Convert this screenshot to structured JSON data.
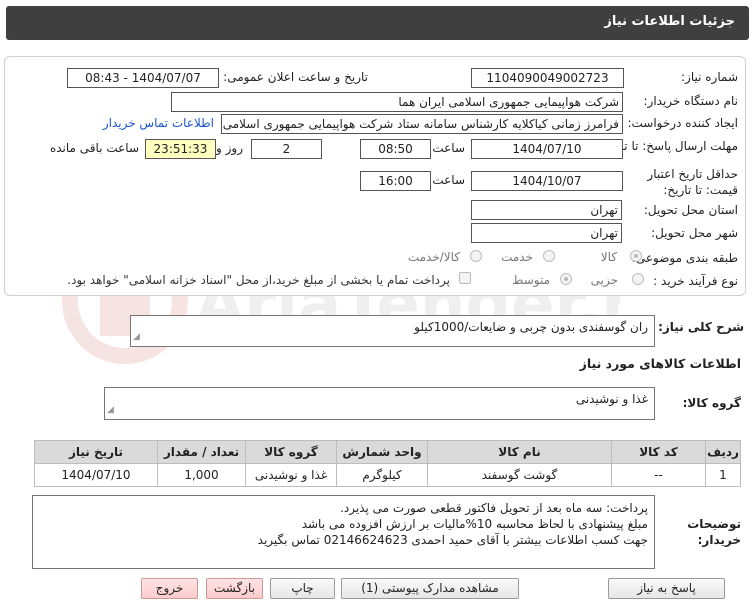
{
  "header": {
    "title": "جزئیات اطلاعات نیاز"
  },
  "watermark": {
    "text": "AriaTender.neT"
  },
  "form": {
    "need_number_label": "شماره نیاز:",
    "need_number": "1104090049002723",
    "announce_label": "تاریخ و ساعت اعلان عمومی:",
    "announce_value": "1404/07/07 - 08:43",
    "buyer_org_label": "نام دستگاه خریدار:",
    "buyer_org": "شرکت هواپیمایی جمهوری اسلامی ایران هما",
    "creator_label": "ایجاد کننده درخواست:",
    "creator": "فرامرز زمانی کیاکلایه کارشناس سامانه ستاد شرکت هواپیمایی جمهوری اسلامی ایران هما",
    "contact_link": "اطلاعات تماس خریدار",
    "reply_deadline_label": "مهلت ارسال پاسخ: تا تاریخ:",
    "reply_date": "1404/07/10",
    "time_label": "ساعت",
    "reply_time": "08:50",
    "days_value": "2",
    "days_label": "روز و",
    "remaining_time": "23:51:33",
    "remaining_label": "ساعت باقی مانده",
    "price_validity_label": "حداقل تاریخ اعتبار قیمت: تا تاریخ:",
    "validity_date": "1404/10/07",
    "validity_time": "16:00",
    "province_label": "استان محل تحویل:",
    "province": "تهران",
    "city_label": "شهر محل تحویل:",
    "city": "تهران",
    "category_label": "طبقه بندی موضوعی:",
    "category_options": [
      "کالا",
      "خدمت",
      "کالا/خدمت"
    ],
    "process_label": "نوع فرآیند خرید :",
    "process_options": [
      "جزیی",
      "متوسط"
    ],
    "payment_note": "پرداخت تمام یا بخشی از مبلغ خرید،از محل \"اسناد خزانه اسلامی\" خواهد بود."
  },
  "summary": {
    "label": "شرح کلی نیاز:",
    "value": "ران گوسفندی بدون چربی و ضایعات/1000کیلو"
  },
  "goods_section_title": "اطلاعات کالاهای مورد نیاز",
  "goods_group": {
    "label": "گروه کالا:",
    "value": "غذا و نوشیدنی"
  },
  "table": {
    "headers": [
      "ردیف",
      "کد کالا",
      "نام کالا",
      "واحد شمارش",
      "گروه کالا",
      "تعداد / مقدار",
      "تاریخ نیاز"
    ],
    "rows": [
      [
        "1",
        "--",
        "گوشت گوسفند",
        "کیلوگرم",
        "غذا و نوشیدنی",
        "1,000",
        "1404/07/10"
      ]
    ]
  },
  "buyer_notes": {
    "label": "توضیحات خریدار:",
    "lines": [
      "پرداخت: سه ماه بعد از تحویل فاکتور قطعی صورت می پذیرد.",
      "مبلغ پیشنهادی با لحاظ محاسبه 10%مالیات بر ارزش افزوده می باشد",
      "جهت کسب اطلاعات بیشتر با آقای حمید احمدی 02146624623 تماس بگیرید"
    ]
  },
  "buttons": {
    "reply": "پاسخ به نیاز",
    "attachments": "مشاهده مدارک پیوستی (1)",
    "print": "چاپ",
    "back": "بازگشت",
    "exit": "خروج"
  }
}
